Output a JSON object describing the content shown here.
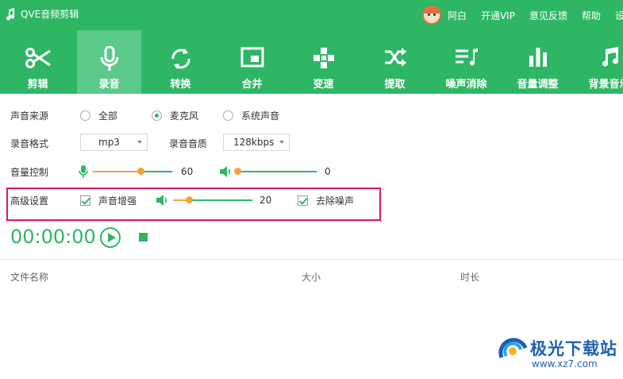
{
  "app": {
    "title": "QVE音频剪辑"
  },
  "topbar": {
    "user": "阿白",
    "vip": "开通VIP",
    "feedback": "意见反馈",
    "help": "帮助",
    "more": "设"
  },
  "toolbar": {
    "items": [
      {
        "label": "剪辑",
        "icon": "scissors-icon"
      },
      {
        "label": "录音",
        "icon": "microphone-icon",
        "active": true
      },
      {
        "label": "转换",
        "icon": "convert-arrows-icon"
      },
      {
        "label": "合并",
        "icon": "merge-window-icon"
      },
      {
        "label": "变速",
        "icon": "speed-cross-icon"
      },
      {
        "label": "提取",
        "icon": "shuffle-icon"
      },
      {
        "label": "噪声消除",
        "icon": "noise-music-icon"
      },
      {
        "label": "音量调整",
        "icon": "volume-bars-icon"
      },
      {
        "label": "背景音乐",
        "icon": "music-note-icon"
      }
    ]
  },
  "settings": {
    "source_label": "声音来源",
    "source_options": [
      "全部",
      "麦克风",
      "系统声音"
    ],
    "source_selected": "麦克风",
    "format_label": "录音格式",
    "format_value": "mp3",
    "quality_label": "录音音质",
    "quality_value": "128kbps",
    "volume_label": "音量控制",
    "mic_volume": 60,
    "system_volume": 0,
    "advanced_label": "高级设置",
    "enhance_label": "声音增强",
    "enhance_checked": true,
    "enhance_volume": 20,
    "denoise_label": "去除噪声",
    "denoise_checked": true
  },
  "recorder": {
    "time": "00:00:00"
  },
  "table": {
    "columns": [
      "文件名称",
      "大小",
      "时长"
    ]
  },
  "watermark": {
    "name": "极光下载站",
    "url": "www.xz7.com"
  },
  "colors": {
    "accent": "#2eb665",
    "slider": "#f7a13a",
    "highlight": "#e0155e"
  }
}
